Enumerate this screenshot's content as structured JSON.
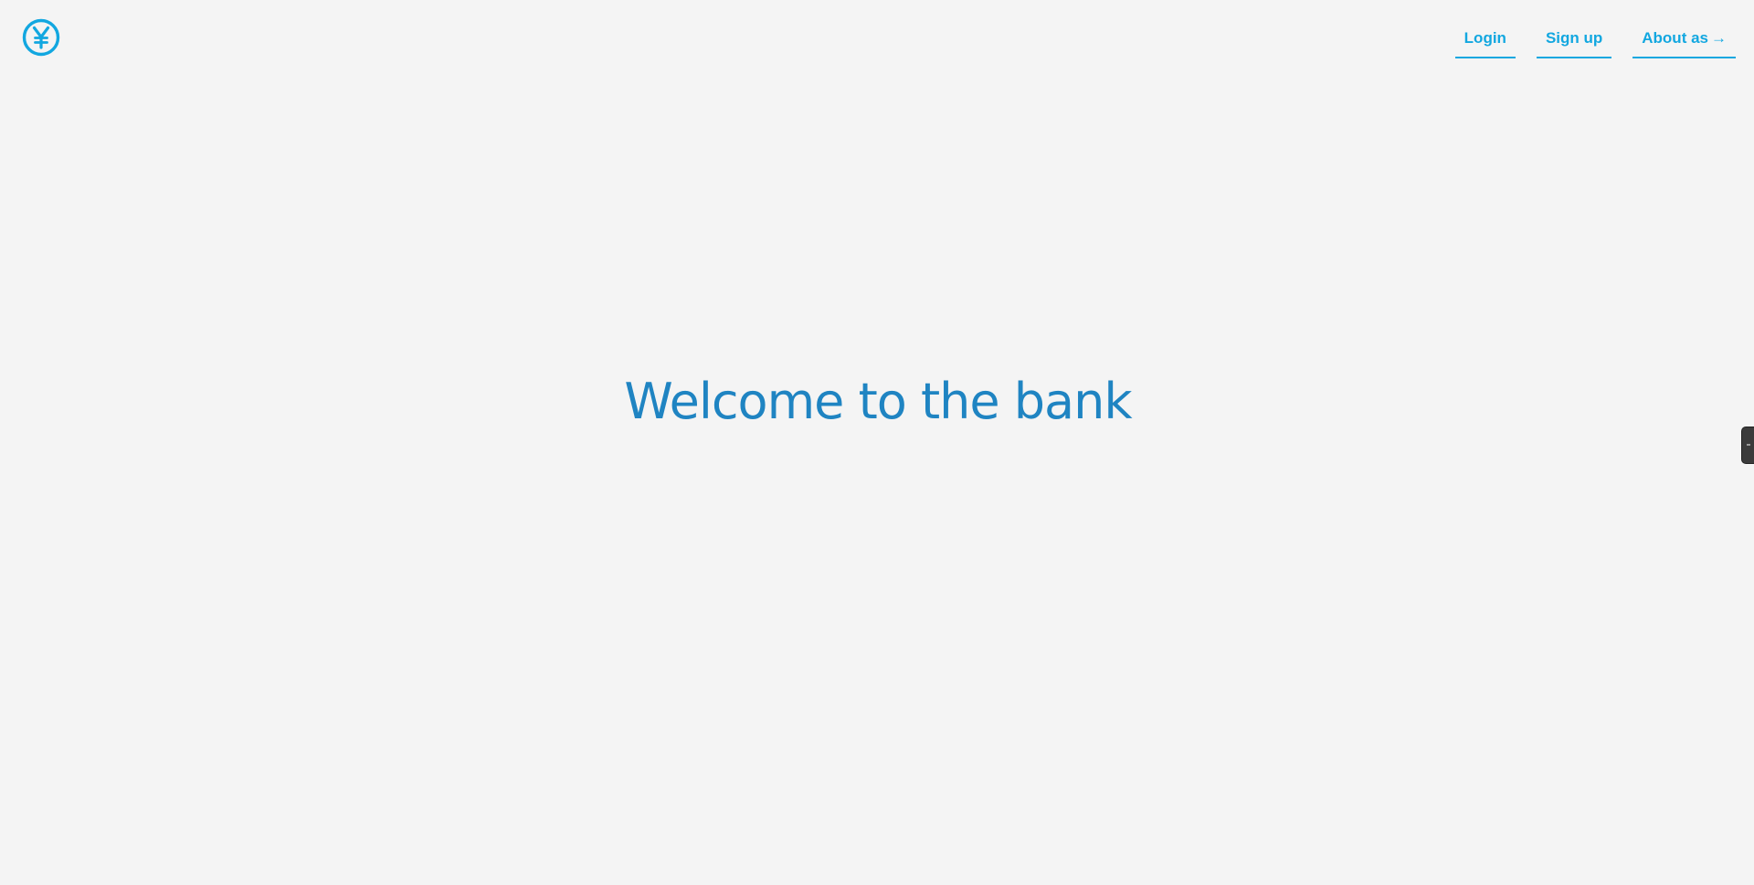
{
  "brand": {
    "logo_icon": "yen-circle-icon",
    "accent_color": "#12a7e0",
    "heading_color": "#1f84c2",
    "background_color": "#f4f4f4"
  },
  "nav": {
    "login_label": "Login",
    "signup_label": "Sign up",
    "about_label": "About as",
    "about_arrow": "→"
  },
  "hero": {
    "title": "Welcome to the bank"
  },
  "side_tab": {
    "icon": "grip-handle-icon"
  }
}
